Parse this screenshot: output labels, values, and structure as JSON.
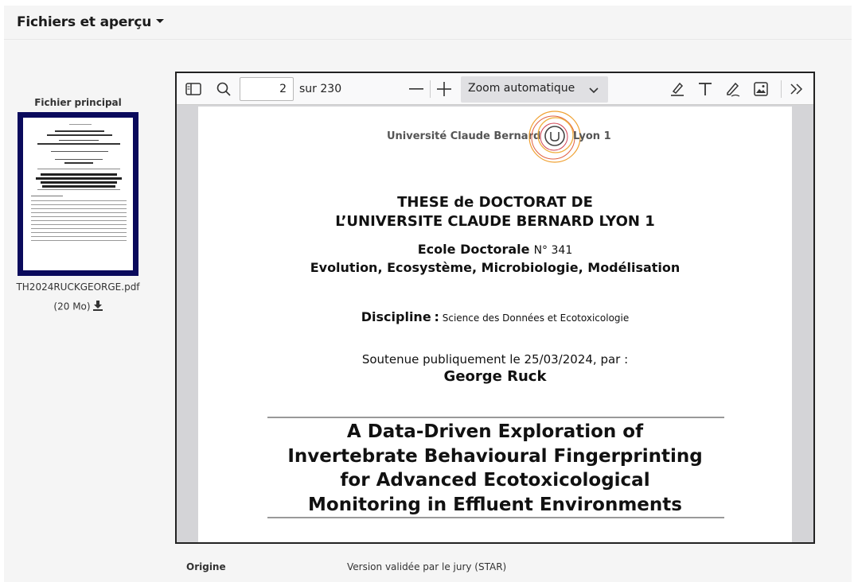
{
  "section": {
    "title": "Fichiers et aperçu"
  },
  "file": {
    "label": "Fichier principal",
    "name": "TH2024RUCKGEORGE.pdf",
    "size": "(20 Mo)"
  },
  "viewer": {
    "current_page": "2",
    "page_of": "sur 230",
    "zoom": "Zoom automatique",
    "icons": [
      "sidebar-toggle-icon",
      "search-icon",
      "zoom-out-icon",
      "zoom-in-icon",
      "highlight-icon",
      "text-icon",
      "draw-icon",
      "image-icon",
      "more-tools-icon"
    ]
  },
  "pdf_page": {
    "university_left": "Université Claude Bernard",
    "university_right": "Lyon 1",
    "title_line1": "THESE de DOCTORAT DE",
    "title_line2": "L’UNIVERSITE CLAUDE BERNARD LYON 1",
    "ecole_label": "Ecole Doctorale",
    "ecole_number": "N° 341",
    "ecole_name": "Evolution, Ecosystème, Microbiologie, Modélisation",
    "discipline_label": "Discipline",
    "discipline_sep": ":",
    "discipline_value": "Science des Données et Ecotoxicologie",
    "soutenue": "Soutenue publiquement le 25/03/2024, par :",
    "author": "George Ruck",
    "thesis_title_lines": [
      "A Data-Driven Exploration of",
      "Invertebrate Behavioural Fingerprinting",
      "for Advanced Ecotoxicological",
      "Monitoring in Effluent Environments"
    ]
  },
  "meta": {
    "origin_label": "Origine",
    "origin_value": "Version validée par le jury (STAR)"
  }
}
